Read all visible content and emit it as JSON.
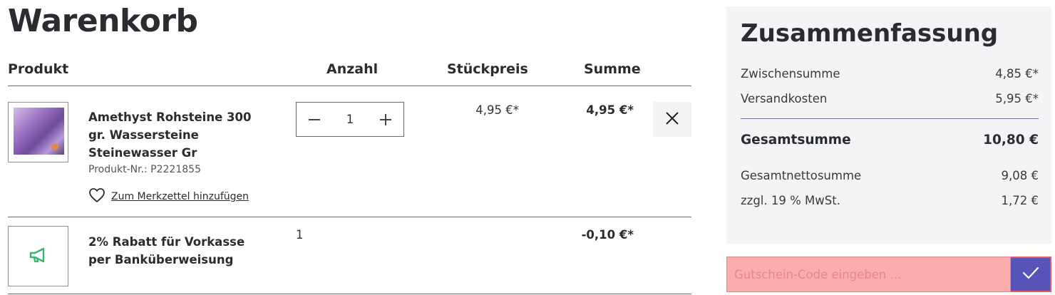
{
  "page": {
    "title": "Warenkorb"
  },
  "cart": {
    "headers": {
      "product": "Produkt",
      "quantity": "Anzahl",
      "unit_price": "Stückpreis",
      "total": "Summe"
    },
    "items": [
      {
        "name": "Amethyst Rohsteine 300 gr. Wassersteine Steinewasser Gr",
        "sku": "Produkt-Nr.: P2221855",
        "wishlist_label": "Zum Merkzettel hinzufügen",
        "quantity": "1",
        "unit_price": "4,95 €*",
        "total": "4,95 €*"
      },
      {
        "name": "2% Rabatt für Vorkasse per Banküberweisung",
        "quantity": "1",
        "total": "-0,10 €*"
      }
    ]
  },
  "summary": {
    "title": "Zusammenfassung",
    "subtotal_label": "Zwischensumme",
    "subtotal_value": "4,85 €*",
    "shipping_label": "Versandkosten",
    "shipping_value": "5,95 €*",
    "grand_total_label": "Gesamtsumme",
    "grand_total_value": "10,80 €",
    "net_label": "Gesamtnettosumme",
    "net_value": "9,08 €",
    "vat_label": "zzgl. 19 % MwSt.",
    "vat_value": "1,72 €"
  },
  "voucher": {
    "placeholder": "Gutschein-Code eingeben ..."
  },
  "colors": {
    "accent": "#5654b8",
    "summary_bg": "#f3f4f5",
    "voucher_error_bg": "#fbadad",
    "promo_icon": "#3cb46e"
  },
  "icons": [
    "heart-icon",
    "minus-icon",
    "plus-icon",
    "close-icon",
    "megaphone-icon",
    "checkmark-icon"
  ]
}
